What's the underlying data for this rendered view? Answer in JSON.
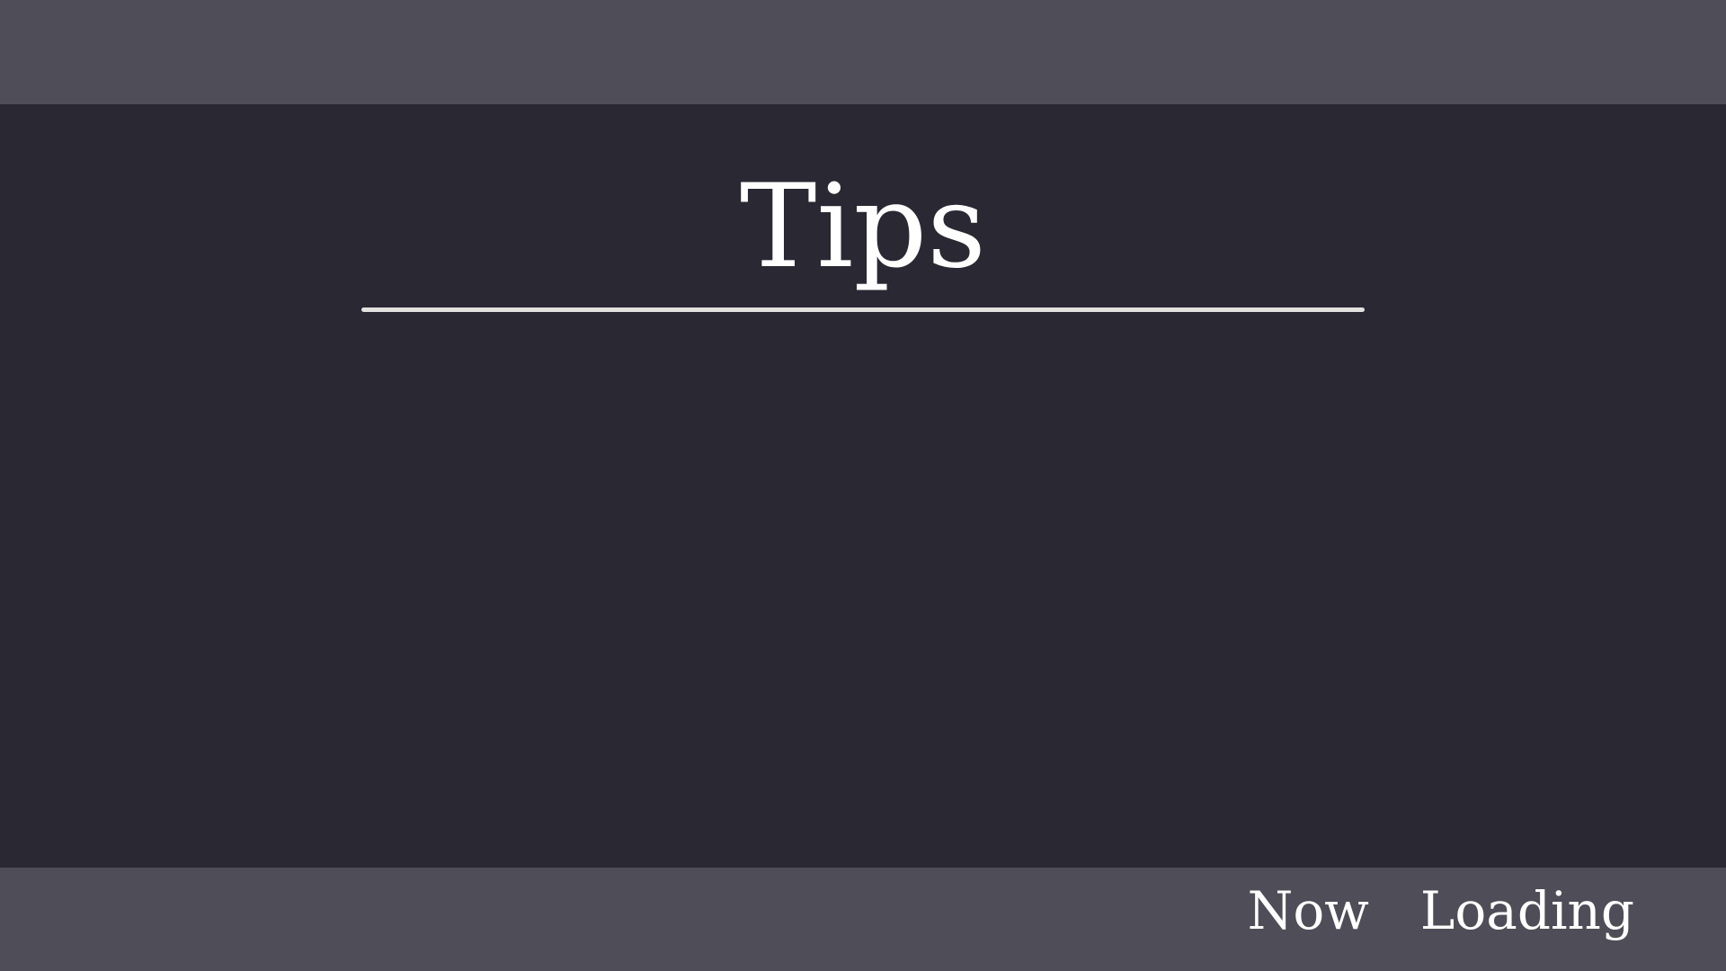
{
  "screen": {
    "title": "Tips",
    "loading_text": "Now  Loading"
  },
  "colors": {
    "background": "#292833",
    "bars": "#4e4d58",
    "divider": "#e4e2df",
    "text": "#ffffff"
  }
}
